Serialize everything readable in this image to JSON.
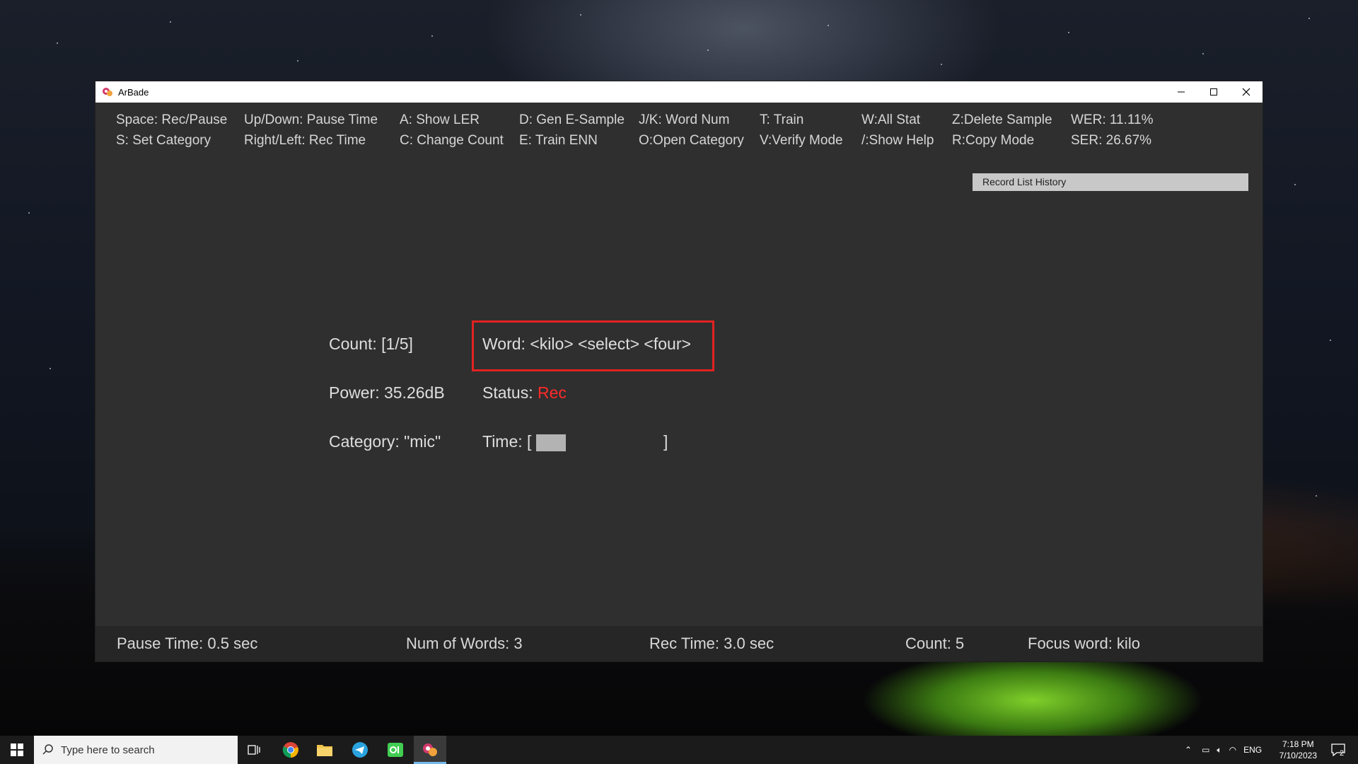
{
  "window": {
    "title": "ArBade",
    "minimize_glyph": "–",
    "maximize_glyph": "☐",
    "close_glyph": "✕"
  },
  "menu": {
    "col1": [
      "Space: Rec/Pause",
      "S: Set Category"
    ],
    "col2": [
      "Up/Down: Pause Time",
      "Right/Left: Rec Time"
    ],
    "col3": [
      "A: Show LER",
      "C: Change Count"
    ],
    "col4": [
      "D: Gen E-Sample",
      "E: Train ENN"
    ],
    "col5": [
      "J/K: Word Num",
      "O:Open Category"
    ],
    "col6": [
      "T: Train",
      "V:Verify Mode"
    ],
    "col7": [
      "W:All Stat",
      "/:Show Help"
    ],
    "col8": [
      "Z:Delete Sample",
      "R:Copy Mode"
    ],
    "col9": [
      "WER: 11.11%",
      "SER:  26.67%"
    ]
  },
  "record_history_label": "Record List History",
  "main": {
    "count": "Count: [1/5]",
    "word": "Word: <kilo> <select> <four>",
    "power": "Power: 35.26dB",
    "status_label": "Status: ",
    "status_value": "Rec",
    "category": "Category: \"mic\"",
    "time_open": "Time: [",
    "time_close": "]",
    "time_progress": 0.2
  },
  "statusbar": {
    "pause_time": "Pause Time: 0.5 sec",
    "num_words": "Num of Words: 3",
    "rec_time": "Rec Time: 3.0 sec",
    "count": "Count: 5",
    "focus_word": "Focus word: kilo"
  },
  "taskbar": {
    "search_placeholder": "Type here to search",
    "language": "ENG",
    "time": "7:18 PM",
    "date": "7/10/2023",
    "notification_count": "2",
    "apps": [
      "task-view-icon",
      "chrome-icon",
      "file-explorer-icon",
      "telegram-icon",
      "qt-creator-icon",
      "arbade-icon"
    ]
  },
  "colors": {
    "window_bg": "#2f2f2f",
    "status_rec": "#ff2a2a",
    "highlight_box": "#e32222"
  }
}
